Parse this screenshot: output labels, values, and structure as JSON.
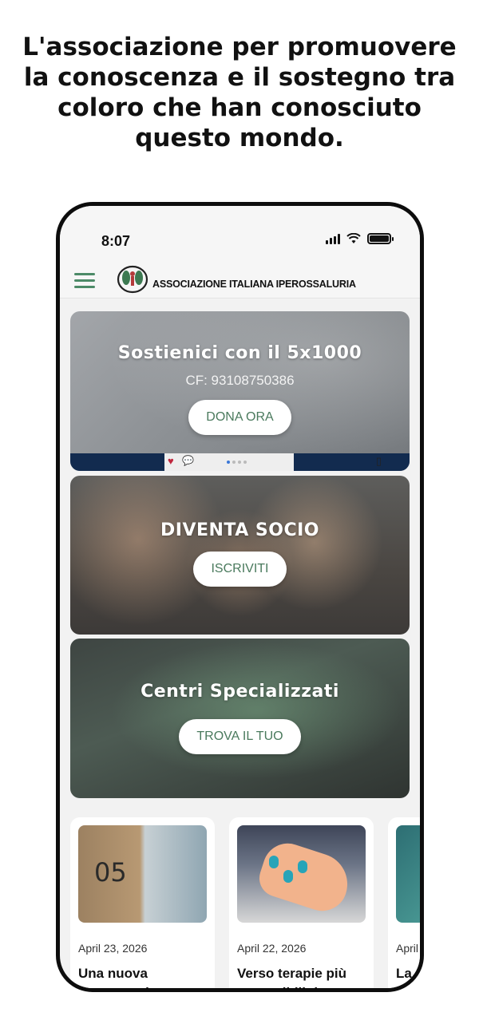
{
  "headline": "L'associazione per promuovere la conoscenza e il sostegno tra coloro che han conosciuto questo mondo.",
  "status_bar": {
    "time": "8:07"
  },
  "app_bar": {
    "brand": "ASSOCIAZIONE ITALIANA IPEROSSALURIA"
  },
  "cards": [
    {
      "title": "Sostienici con il 5x1000",
      "subtitle": "CF: 93108750386",
      "button": "DONA ORA"
    },
    {
      "title": "DIVENTA SOCIO",
      "button": "ISCRIVITI"
    },
    {
      "title": "Centri Specializzati",
      "button": "TROVA IL TUO"
    }
  ],
  "news": [
    {
      "thumb_text": "05",
      "date": "April 23, 2026",
      "title": "Una nuova speranza: la"
    },
    {
      "date": "April 22, 2026",
      "title": "Verso terapie più accessibili: la"
    },
    {
      "date": "April",
      "title": "La"
    }
  ],
  "colors": {
    "accent": "#4c8a67",
    "button_text": "#4a7a5d"
  }
}
